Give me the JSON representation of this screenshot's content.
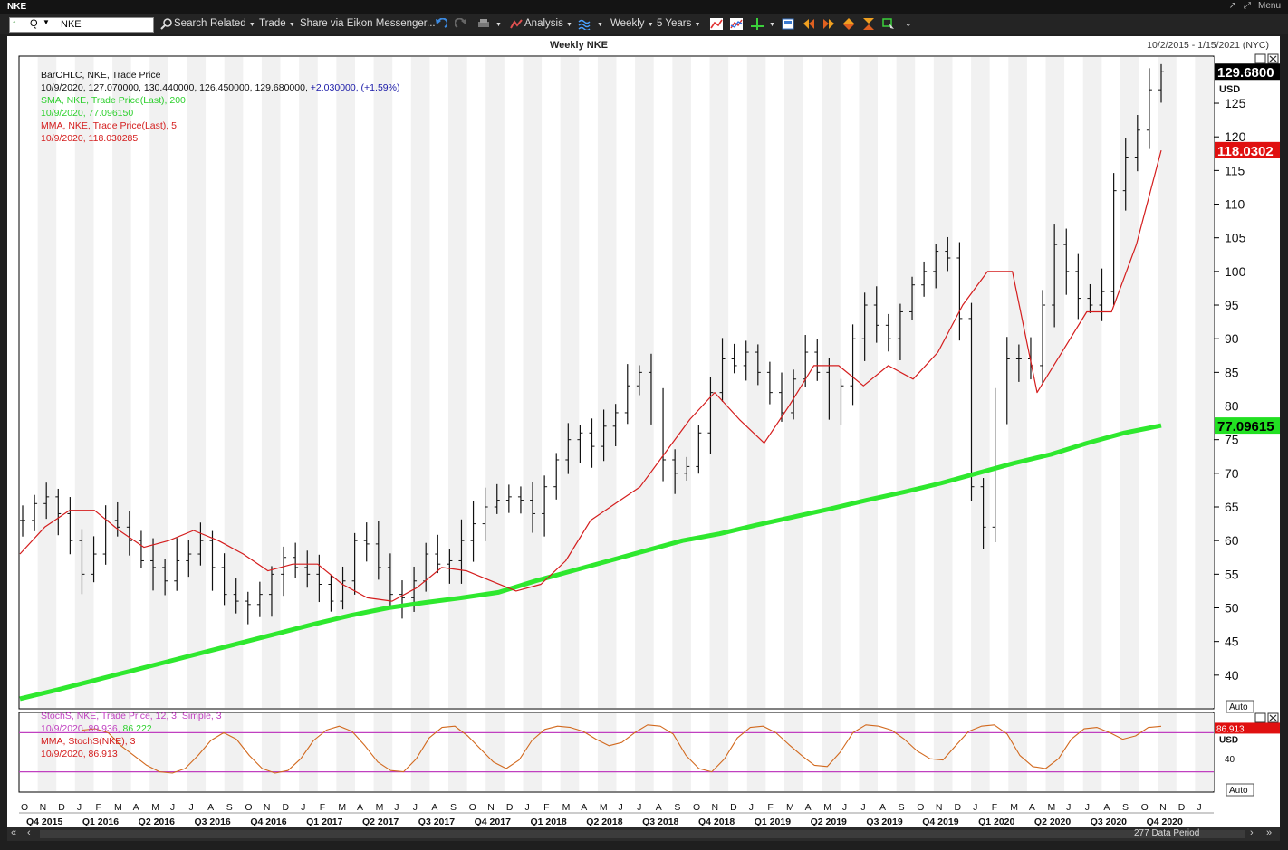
{
  "window": {
    "title": "NKE",
    "controls": [
      "↗",
      "⤢",
      "Menu"
    ]
  },
  "toolbar": {
    "ric_value": "NKE",
    "ric_q": "Q",
    "search_label": "Search",
    "related_label": "Related",
    "trade_label": "Trade",
    "share_label": "Share via Eikon Messenger...",
    "analysis_label": "Analysis",
    "interval_label": "Weekly",
    "period_label": "5 Years"
  },
  "chart_header": {
    "title": "Weekly NKE",
    "date_range": "10/2/2015 - 1/15/2021 (NYC)"
  },
  "legend_main": {
    "line1": "BarOHLC, NKE, Trade Price",
    "line2": "10/9/2020, 127.070000, 130.440000, 126.450000, 129.680000,",
    "line2_change": "+2.030000, (+1.59%)",
    "line3": "SMA, NKE, Trade Price(Last),  200",
    "line4": "10/9/2020, 77.096150",
    "line5": "MMA, NKE, Trade Price(Last),  5",
    "line6": "10/9/2020, 118.030285"
  },
  "legend_stoch": {
    "line1": "StochS, NKE, Trade Price,  12, 3, Simple,  3",
    "line2": "10/9/2020, 89.936,",
    "line2b": "86.222",
    "line3": "MMA, StochS(NKE),  3",
    "line4": "10/9/2020, 86.913"
  },
  "price_labels": {
    "last": "129.6800",
    "mma": "118.0302",
    "sma": "77.09615",
    "currency": "USD"
  },
  "stoch_labels": {
    "value": "86.913",
    "currency": "USD",
    "tick40": "40"
  },
  "auto_label": "Auto",
  "status": {
    "data_period": "277 Data Period"
  },
  "colors": {
    "bars": "#111111",
    "sma": "#2ee82e",
    "mma": "#d41d1d",
    "stoch": "#d2691e",
    "stoch_band": "#c040c0",
    "last_tag": "#000000",
    "mma_tag": "#e01010",
    "sma_tag": "#22e022"
  },
  "chart_data": [
    {
      "type": "line",
      "title": "Weekly NKE",
      "ylabel": "USD",
      "ylim": [
        35,
        132
      ],
      "yticks": [
        40,
        45,
        50,
        55,
        60,
        65,
        70,
        75,
        80,
        85,
        90,
        95,
        100,
        105,
        110,
        115,
        120,
        125
      ],
      "x_months": [
        "O",
        "N",
        "D",
        "J",
        "F",
        "M",
        "A",
        "M",
        "J",
        "J",
        "A",
        "S",
        "O",
        "N",
        "D",
        "J",
        "F",
        "M",
        "A",
        "M",
        "J",
        "J",
        "A",
        "S",
        "O",
        "N",
        "D",
        "J",
        "F",
        "M",
        "A",
        "M",
        "J",
        "J",
        "A",
        "S",
        "O",
        "N",
        "D",
        "J",
        "F",
        "M",
        "A",
        "M",
        "J",
        "J",
        "A",
        "S",
        "O",
        "N",
        "D",
        "J",
        "F",
        "M",
        "A",
        "M",
        "J",
        "J",
        "A",
        "S",
        "O",
        "N",
        "D",
        "J"
      ],
      "x_quarters": [
        "Q4 2015",
        "Q1 2016",
        "Q2 2016",
        "Q3 2016",
        "Q4 2016",
        "Q1 2017",
        "Q2 2017",
        "Q3 2017",
        "Q4 2017",
        "Q1 2018",
        "Q2 2018",
        "Q3 2018",
        "Q4 2018",
        "Q1 2019",
        "Q2 2019",
        "Q3 2019",
        "Q4 2019",
        "Q1 2020",
        "Q2 2020",
        "Q3 2020",
        "Q4 2020"
      ],
      "series": [
        {
          "name": "BarOHLC, NKE, Trade Price",
          "kind": "ohlc",
          "values": [
            63,
            65.5,
            66.5,
            64,
            60,
            55,
            58,
            63,
            62,
            60,
            57,
            56,
            54,
            57,
            58,
            60,
            56,
            52,
            51,
            50.5,
            52,
            55,
            57.5,
            56,
            55,
            53.5,
            51,
            54,
            60,
            59.5,
            56,
            52,
            51.5,
            54,
            58,
            56.5,
            57,
            60,
            62.5,
            65,
            66,
            66.5,
            66,
            64,
            68,
            72,
            75,
            76,
            74,
            77,
            79,
            83,
            85,
            80,
            72,
            70,
            71,
            76,
            82,
            87,
            86,
            88,
            85,
            82,
            79,
            84,
            88,
            85,
            80,
            83,
            90,
            95,
            92,
            90,
            94,
            98,
            100,
            103,
            102,
            93,
            68,
            62,
            80,
            87,
            87,
            86,
            95,
            104,
            100,
            96,
            95,
            97,
            112,
            117,
            121,
            127,
            129.68
          ]
        },
        {
          "name": "SMA, NKE, Trade Price(Last), 200",
          "values": [
            36.5,
            37.8,
            39.2,
            40.6,
            42,
            43.4,
            44.8,
            46.2,
            47.6,
            48.9,
            50,
            50.8,
            51.5,
            52.3,
            54,
            55.5,
            57,
            58.5,
            60,
            61,
            62.3,
            63.5,
            64.7,
            66,
            67.2,
            68.5,
            70,
            71.5,
            72.8,
            74.5,
            76,
            77.1
          ]
        },
        {
          "name": "MMA, NKE, Trade Price(Last), 5",
          "values": [
            58,
            62,
            64.5,
            64.5,
            61.5,
            59,
            60,
            61.5,
            60,
            58,
            55.5,
            56.5,
            56.5,
            53.5,
            51.5,
            51,
            53,
            56,
            55.5,
            54,
            52.5,
            53.5,
            57,
            63,
            65.5,
            68,
            73,
            78,
            82,
            78,
            74.5,
            80,
            86,
            86,
            83,
            86,
            84,
            88,
            95,
            100,
            100,
            82,
            88,
            94,
            94,
            104,
            118
          ]
        }
      ]
    },
    {
      "type": "line",
      "title": "StochS, NKE, Trade Price, 12, 3, Simple, 3",
      "ylim": [
        0,
        100
      ],
      "bands": [
        20,
        80
      ],
      "series": [
        {
          "name": "StochS",
          "values": [
            84,
            86,
            80,
            60,
            45,
            30,
            20,
            18,
            25,
            45,
            68,
            80,
            70,
            45,
            25,
            18,
            22,
            40,
            68,
            84,
            90,
            82,
            60,
            35,
            22,
            20,
            40,
            72,
            88,
            90,
            75,
            55,
            35,
            25,
            38,
            68,
            85,
            90,
            88,
            82,
            70,
            60,
            65,
            80,
            92,
            90,
            78,
            45,
            25,
            20,
            40,
            72,
            88,
            90,
            80,
            62,
            45,
            30,
            28,
            50,
            80,
            92,
            90,
            84,
            70,
            52,
            40,
            38,
            60,
            82,
            90,
            92,
            78,
            45,
            28,
            25,
            40,
            70,
            86,
            88,
            80,
            70,
            75,
            88,
            89.9
          ]
        },
        {
          "name": "MMA, StochS(NKE), 3",
          "values": [
            86.9
          ]
        }
      ]
    }
  ]
}
